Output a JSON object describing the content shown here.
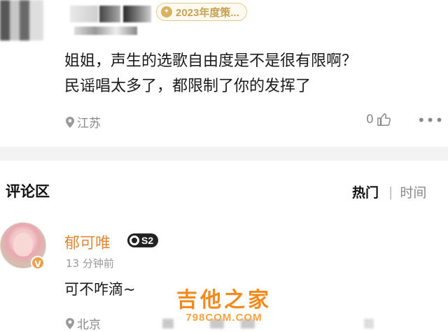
{
  "post": {
    "badge_text": "2023年度策...",
    "comment_lines": [
      "姐姐，声生的选歌自由度是不是很有限啊？",
      "民谣唱太多了，都限制了你的发挥了"
    ],
    "location": "江苏",
    "like_count": "0"
  },
  "section": {
    "title": "评论区",
    "sort_hot": "热门",
    "sort_separator": "|",
    "sort_time": "时间"
  },
  "reply": {
    "username": "郁可唯",
    "level": "S2",
    "verify": "V",
    "time": "13 分钟前",
    "text": "可不咋滴~",
    "location": "北京"
  },
  "watermark": {
    "main": "吉他之家",
    "sub": "798COM.COM"
  },
  "colors": {
    "accent_username": "#e08a3a",
    "badge_gold": "#c7a255",
    "watermark_orange": "#f28a1e"
  },
  "icons": [
    "location-pin-icon",
    "thumbs-up-icon",
    "more-dots-icon",
    "verified-v-icon",
    "level-ring-icon",
    "award-badge-icon"
  ]
}
